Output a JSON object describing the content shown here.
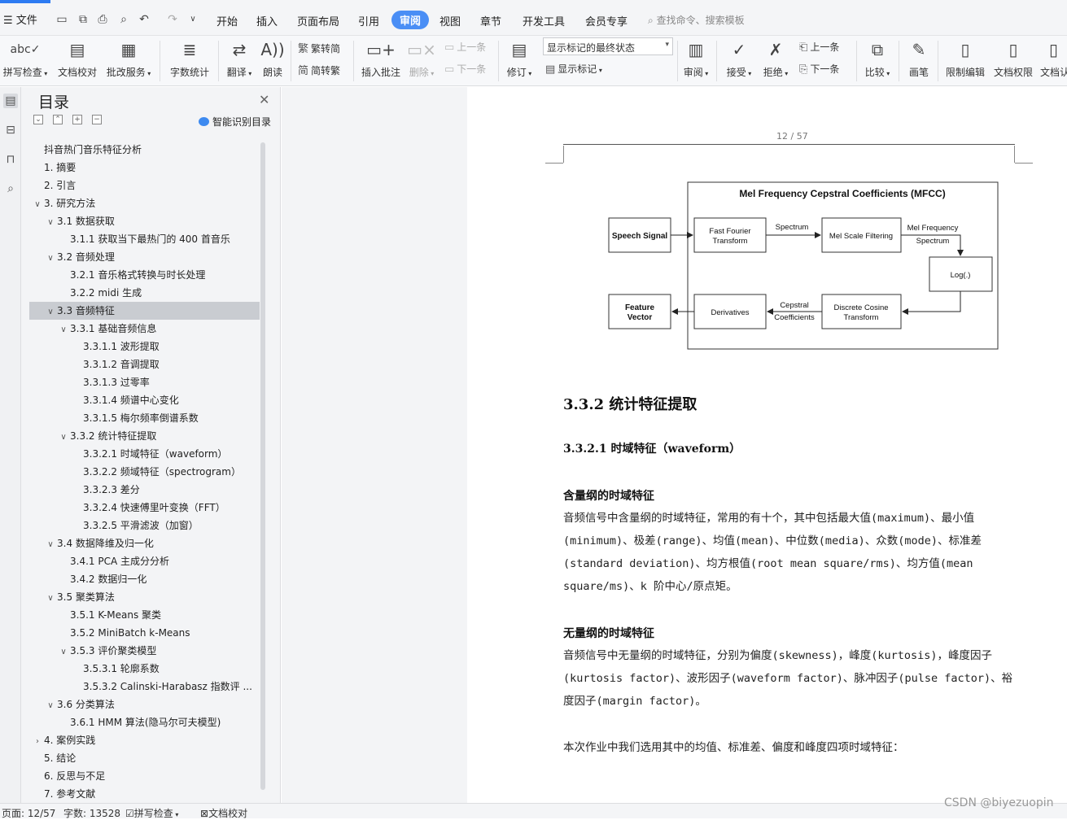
{
  "menubar": {
    "file_label": "文件",
    "tabs": [
      "开始",
      "插入",
      "页面布局",
      "引用",
      "审阅",
      "视图",
      "章节",
      "开发工具",
      "会员专享"
    ],
    "active_tab": "审阅",
    "search_placeholder": "查找命令、搜索模板"
  },
  "ribbon": {
    "spell_check": "拼写检查",
    "doc_proofread": "文档校对",
    "batch_service": "批改服务",
    "word_count": "字数统计",
    "translate": "翻译",
    "read_aloud": "朗读",
    "trad_to_simp": "繁转简",
    "simp_to_trad": "简转繁",
    "insert_comment": "插入批注",
    "delete": "删除",
    "prev_item": "上一条",
    "next_item": "下一条",
    "revise": "修订",
    "markup_mode": "显示标记的最终状态",
    "show_markup": "显示标记",
    "review": "审阅",
    "accept": "接受",
    "reject": "拒绝",
    "prev_change": "上一条",
    "next_change": "下一条",
    "compare": "比较",
    "pen": "画笔",
    "restrict_edit": "限制编辑",
    "doc_permission": "文档权限",
    "doc_check": "文档认"
  },
  "toc": {
    "title": "目录",
    "smart_label": "智能识别目录",
    "items": [
      {
        "text": "抖音热门音乐特征分析",
        "level": 0,
        "toggle": ""
      },
      {
        "text": "1.  摘要",
        "level": 0,
        "toggle": ""
      },
      {
        "text": "2.  引言",
        "level": 0,
        "toggle": ""
      },
      {
        "text": "3.  研究方法",
        "level": 0,
        "toggle": "∨"
      },
      {
        "text": "3.1  数据获取",
        "level": 1,
        "toggle": "∨"
      },
      {
        "text": "3.1.1  获取当下最热门的 400 首音乐",
        "level": 2,
        "toggle": ""
      },
      {
        "text": "3.2  音频处理",
        "level": 1,
        "toggle": "∨"
      },
      {
        "text": "3.2.1  音乐格式转换与时长处理",
        "level": 2,
        "toggle": ""
      },
      {
        "text": "3.2.2 midi 生成",
        "level": 2,
        "toggle": ""
      },
      {
        "text": "3.3  音频特征",
        "level": 1,
        "toggle": "∨",
        "selected": true
      },
      {
        "text": "3.3.1  基础音频信息",
        "level": 2,
        "toggle": "∨"
      },
      {
        "text": "3.3.1.1  波形提取",
        "level": 3,
        "toggle": ""
      },
      {
        "text": "3.3.1.2  音调提取",
        "level": 3,
        "toggle": ""
      },
      {
        "text": "3.3.1.3  过零率",
        "level": 3,
        "toggle": ""
      },
      {
        "text": "3.3.1.4  频谱中心变化",
        "level": 3,
        "toggle": ""
      },
      {
        "text": "3.3.1.5  梅尔频率倒谱系数",
        "level": 3,
        "toggle": ""
      },
      {
        "text": "3.3.2  统计特征提取",
        "level": 2,
        "toggle": "∨"
      },
      {
        "text": "3.3.2.1  时域特征（waveform）",
        "level": 3,
        "toggle": ""
      },
      {
        "text": "3.3.2.2  频域特征（spectrogram）",
        "level": 3,
        "toggle": ""
      },
      {
        "text": "3.3.2.3  差分",
        "level": 3,
        "toggle": ""
      },
      {
        "text": "3.3.2.4  快速傅里叶变换（FFT）",
        "level": 3,
        "toggle": ""
      },
      {
        "text": "3.3.2.5  平滑滤波（加窗）",
        "level": 3,
        "toggle": ""
      },
      {
        "text": "3.4  数据降维及归一化",
        "level": 1,
        "toggle": "∨"
      },
      {
        "text": "3.4.1 PCA 主成分分析",
        "level": 2,
        "toggle": ""
      },
      {
        "text": "3.4.2  数据归一化",
        "level": 2,
        "toggle": ""
      },
      {
        "text": "3.5  聚类算法",
        "level": 1,
        "toggle": "∨"
      },
      {
        "text": "3.5.1 K-Means 聚类",
        "level": 2,
        "toggle": ""
      },
      {
        "text": "3.5.2 MiniBatch k-Means",
        "level": 2,
        "toggle": ""
      },
      {
        "text": "3.5.3  评价聚类模型",
        "level": 2,
        "toggle": "∨"
      },
      {
        "text": "3.5.3.1  轮廓系数",
        "level": 3,
        "toggle": ""
      },
      {
        "text": "3.5.3.2 Calinski-Harabasz 指数评 ...",
        "level": 3,
        "toggle": ""
      },
      {
        "text": "3.6  分类算法",
        "level": 1,
        "toggle": "∨"
      },
      {
        "text": "3.6.1 HMM 算法(隐马尔可夫模型)",
        "level": 2,
        "toggle": ""
      },
      {
        "text": "4.  案例实践",
        "level": 0,
        "toggle": "›"
      },
      {
        "text": "5.  结论",
        "level": 0,
        "toggle": ""
      },
      {
        "text": "6.  反思与不足",
        "level": 0,
        "toggle": ""
      },
      {
        "text": "7.  参考文献",
        "level": 0,
        "toggle": ""
      }
    ]
  },
  "document": {
    "page_indicator": "12 / 57",
    "diagram": {
      "title": "Mel Frequency Cepstral Coefficients (MFCC)",
      "speech_signal": "Speech Signal",
      "fft_line1": "Fast Fourier",
      "fft_line2": "Transform",
      "spectrum_label": "Spectrum",
      "mel_filter": "Mel Scale Filtering",
      "mel_spec_line1": "Mel Frequency",
      "mel_spec_line2": "Spectrum",
      "log": "Log(.)",
      "dct_line1": "Discrete Cosine",
      "dct_line2": "Transform",
      "cepstral_line1": "Cepstral",
      "cepstral_line2": "Coefficients",
      "derivatives": "Derivatives",
      "feature_line1": "Feature",
      "feature_line2": "Vector"
    },
    "heading2": "3.3.2 统计特征提取",
    "heading3": "3.3.2.1 时域特征（waveform）",
    "sub1": "含量纲的时域特征",
    "para1": "音频信号中含量纲的时域特征，常用的有十个，其中包括最大值(maximum)、最小值(minimum)、极差(range)、均值(mean)、中位数(media)、众数(mode)、标准差(standard deviation)、均方根值(root mean square/rms)、均方值(mean square/ms)、k 阶中心/原点矩。",
    "sub2": "无量纲的时域特征",
    "para2": "音频信号中无量纲的时域特征，分别为偏度(skewness)，峰度(kurtosis)，峰度因子(kurtosis factor)、波形因子(waveform factor)、脉冲因子(pulse factor)、裕度因子(margin factor)。",
    "para3": "本次作业中我们选用其中的均值、标准差、偏度和峰度四项时域特征："
  },
  "status": {
    "page": "页面: 12/57",
    "words": "字数: 13528",
    "spell": "拼写检查",
    "proof": "文档校对"
  },
  "watermark": "CSDN @biyezuopin"
}
